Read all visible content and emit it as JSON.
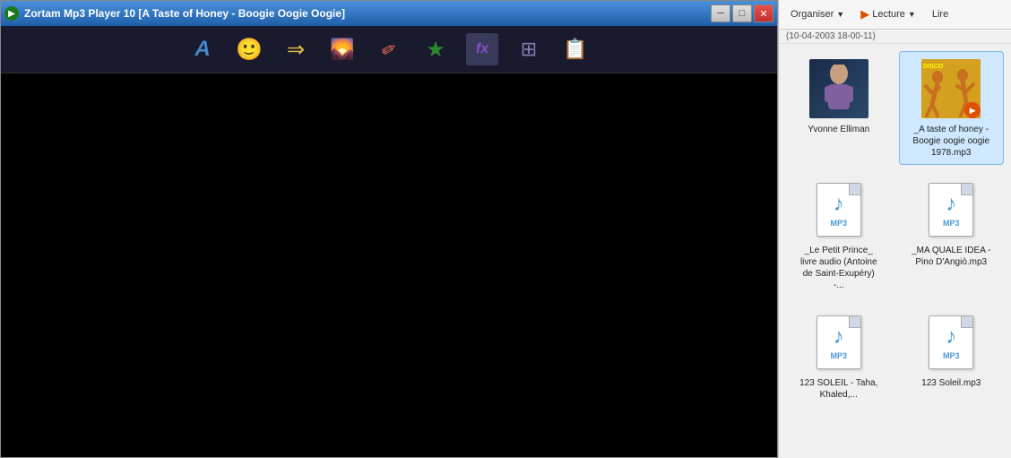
{
  "player": {
    "title": "Zortam Mp3 Player 10 [A Taste of Honey - Boogie Oogie Oogie]",
    "toolbar_buttons": [
      {
        "id": "text-btn",
        "symbol": "A",
        "label": "Text"
      },
      {
        "id": "smiley-btn",
        "symbol": "☺",
        "label": "Smiley"
      },
      {
        "id": "arrow-btn",
        "symbol": "➡",
        "label": "Arrow"
      },
      {
        "id": "image-btn",
        "symbol": "🖼",
        "label": "Image"
      },
      {
        "id": "pencil-btn",
        "symbol": "✏",
        "label": "Pencil"
      },
      {
        "id": "star-btn",
        "symbol": "★",
        "label": "Star"
      },
      {
        "id": "fx-btn",
        "symbol": "fx",
        "label": "FX"
      },
      {
        "id": "grid-btn",
        "symbol": "⊞",
        "label": "Grid"
      },
      {
        "id": "export-btn",
        "symbol": "📋",
        "label": "Export"
      }
    ]
  },
  "filepanel": {
    "toolbar": {
      "organiser_label": "Organiser",
      "lecture_label": "Lecture",
      "lire_label": "Lire"
    },
    "date_label": "(10-04-2003 18-00-11)",
    "files": [
      {
        "id": "yvonne-elliman",
        "name": "Yvonne Elliman",
        "type": "album",
        "style": "yvonne"
      },
      {
        "id": "taste-of-honey",
        "name": "_A taste of honey - Boogie oogie oogie 1978.mp3",
        "type": "album-mp3",
        "style": "taste",
        "has_play": true
      },
      {
        "id": "petit-prince",
        "name": "_Le Petit Prince_ livre audio (Antoine de Saint-Exupéry) -...",
        "type": "mp3"
      },
      {
        "id": "ma-quale-idea",
        "name": "_MA QUALE IDEA - Pino D'Angiò.mp3",
        "type": "mp3"
      },
      {
        "id": "123-soleil",
        "name": "123 SOLEIL - Taha, Khaled,...",
        "type": "mp3"
      },
      {
        "id": "123-soleil-mp3",
        "name": "123 Soleil.mp3",
        "type": "mp3"
      }
    ]
  }
}
